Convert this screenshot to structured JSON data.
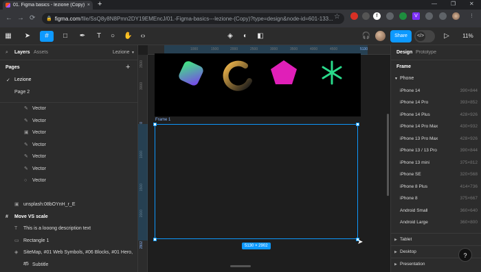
{
  "browser": {
    "tab_title": "01. Figma basics - lezione (Copy)",
    "tab_close": "×",
    "new_tab": "+",
    "url_host": "figma.com",
    "url_path": "/file/SsQ8y8N8Pmn2DY19EMEncJ/01.-Figma-basics---lezione-(Copy)?type=design&node-id=601-133...",
    "back": "←",
    "forward": "→",
    "reload": "⟳",
    "star": "☆",
    "min": "—",
    "max": "❐",
    "close": "✕"
  },
  "toolbar": {
    "share_label": "Share",
    "zoom": "11%",
    "dev_icon": "</>"
  },
  "left_panel": {
    "tab_layers": "Layers",
    "tab_assets": "Assets",
    "page_dropdown": "Lezione",
    "pages_title": "Pages",
    "add_page": "+",
    "pages": [
      "Lezione",
      "Page 2"
    ],
    "layers": [
      {
        "name": "Vector",
        "icon": "path-icon"
      },
      {
        "name": "Vector",
        "icon": "path-icon"
      },
      {
        "name": "Vector",
        "icon": "image-icon"
      },
      {
        "name": "Vector",
        "icon": "path-icon"
      },
      {
        "name": "Vector",
        "icon": "path-icon"
      },
      {
        "name": "Vector",
        "icon": "path-icon"
      },
      {
        "name": "Vector",
        "icon": "ellipse-icon"
      },
      {
        "name": "unsplash:08bOYnH_r_E",
        "icon": "image-icon"
      },
      {
        "name": "Move VS scale",
        "icon": "frame-icon"
      },
      {
        "name": "This is a looong description text",
        "icon": "text-icon"
      },
      {
        "name": "Rectangle 1",
        "icon": "rectangle-icon"
      },
      {
        "name": "SiteMap, #01 Web Symbols, #06 Blocks, #01 Hero, #5",
        "icon": "component-icon"
      },
      {
        "name": "Subtitle",
        "icon": "text-icon"
      }
    ]
  },
  "canvas": {
    "ruler_top": [
      "1000",
      "1500",
      "2000",
      "2500",
      "3000",
      "3500",
      "4000",
      "4500",
      "5130"
    ],
    "ruler_left": [
      "3500",
      "3000",
      "0",
      "1000",
      "1500",
      "2000",
      "2902"
    ],
    "frame_label": "Frame 1",
    "frame_size": "5130 × 2902"
  },
  "right_panel": {
    "tab_design": "Design",
    "tab_prototype": "Prototype",
    "section_frame": "Frame",
    "group_phone": "Phone",
    "presets": [
      {
        "name": "iPhone 14",
        "size": "390×844"
      },
      {
        "name": "iPhone 14 Pro",
        "size": "393×852"
      },
      {
        "name": "iPhone 14 Plus",
        "size": "428×926"
      },
      {
        "name": "iPhone 14 Pro Max",
        "size": "430×932"
      },
      {
        "name": "iPhone 13 Pro Max",
        "size": "428×926"
      },
      {
        "name": "iPhone 13 / 13 Pro",
        "size": "390×844"
      },
      {
        "name": "iPhone 13 mini",
        "size": "375×812"
      },
      {
        "name": "iPhone SE",
        "size": "320×568"
      },
      {
        "name": "iPhone 8 Plus",
        "size": "414×736"
      },
      {
        "name": "iPhone 8",
        "size": "375×667"
      },
      {
        "name": "Android Small",
        "size": "360×640"
      },
      {
        "name": "Android Large",
        "size": "360×800"
      }
    ],
    "groups": [
      "Tablet",
      "Desktop",
      "Presentation"
    ],
    "help": "?"
  },
  "colors": {
    "accent": "#0d99ff",
    "canvas_bg": "#1e1e1e",
    "panel_bg": "#2c2c2c"
  }
}
